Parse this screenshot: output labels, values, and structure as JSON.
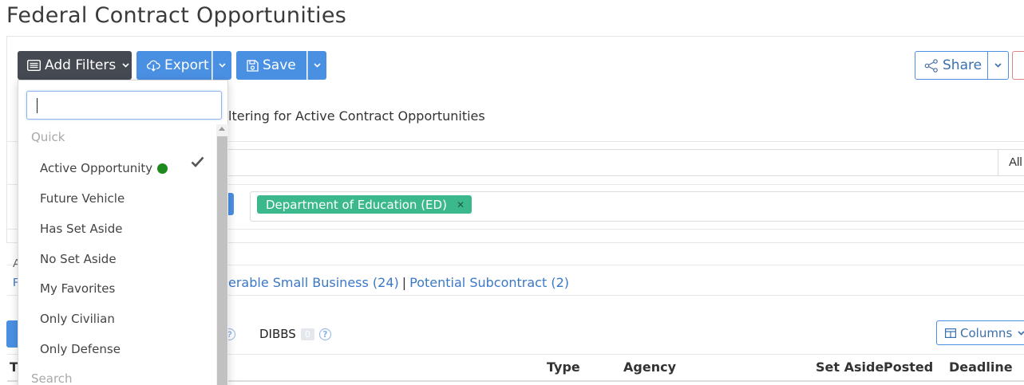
{
  "page": {
    "title": "Federal Contract Opportunities"
  },
  "toolbar": {
    "add_filters_label": "Add Filters",
    "export_label": "Export",
    "save_label": "Save",
    "share_label": "Share"
  },
  "filters": {
    "status_text": "ltering for Active Contract Opportunities",
    "field_right_label": "All",
    "agency_tag": "Department of Education (ED)"
  },
  "links": {
    "item1": "erable Small Business (24)",
    "separator": "|",
    "item2": "Potential Subcontract (2)"
  },
  "left_stubs": {
    "a": "A",
    "r": "R",
    "t": "T"
  },
  "tabs": {
    "dibbs_label": "DIBBS",
    "dibbs_count": "0",
    "help_glyph": "?"
  },
  "columns_button": "Columns",
  "table": {
    "headers": {
      "type": "Type",
      "agency": "Agency",
      "set_aside": "Set Aside",
      "posted": "Posted",
      "deadline": "Deadline"
    }
  },
  "dropdown": {
    "search_placeholder": "",
    "groups": {
      "quick": "Quick",
      "search": "Search"
    },
    "items": [
      {
        "label": "Active Opportunity",
        "checked": true,
        "status_color": "#1e8a1e"
      },
      {
        "label": "Future Vehicle"
      },
      {
        "label": "Has Set Aside"
      },
      {
        "label": "No Set Aside"
      },
      {
        "label": "My Favorites"
      },
      {
        "label": "Only Civilian"
      },
      {
        "label": "Only Defense"
      }
    ]
  },
  "colors": {
    "primary": "#4a90e2",
    "dark_button": "#454a52",
    "tag": "#3bb98d"
  }
}
